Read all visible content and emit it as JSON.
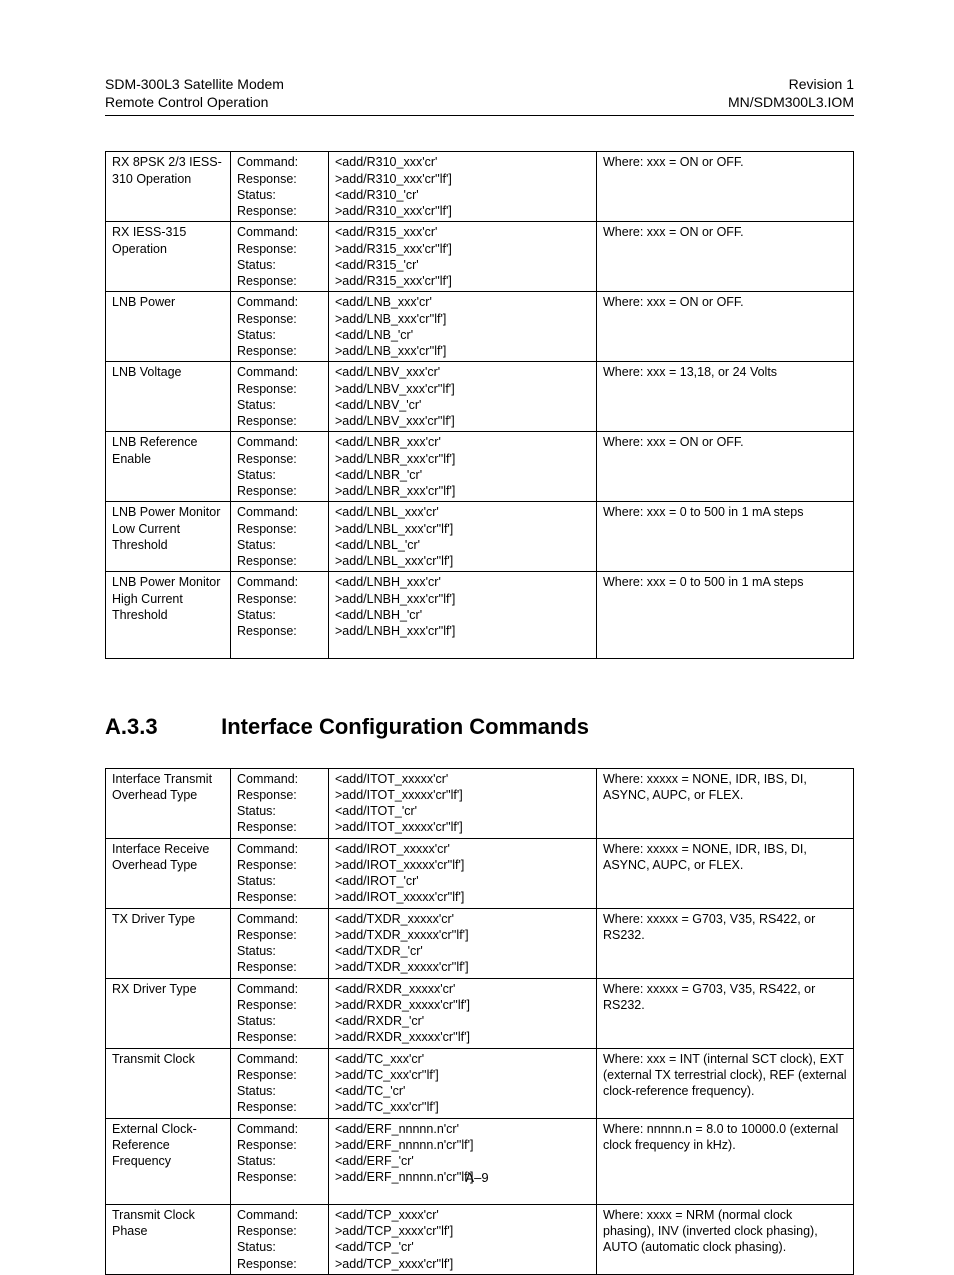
{
  "header": {
    "left1": "SDM-300L3 Satellite Modem",
    "left2": "Remote Control Operation",
    "right1": "Revision 1",
    "right2": "MN/SDM300L3.IOM"
  },
  "labels": {
    "command": "Command:",
    "response": "Response:",
    "status": "Status:"
  },
  "section": {
    "num": "A.3.3",
    "title": "Interface Configuration Commands"
  },
  "table1": [
    {
      "name": "RX 8PSK 2/3 IESS-310 Operation",
      "cmds": [
        "<add/R310_xxx'cr'",
        ">add/R310_xxx'cr''lf']",
        "<add/R310_'cr'",
        ">add/R310_xxx'cr''lf']"
      ],
      "desc": "Where: xxx = ON or OFF."
    },
    {
      "name": "RX IESS-315 Operation",
      "cmds": [
        "<add/R315_xxx'cr'",
        ">add/R315_xxx'cr''lf']",
        "<add/R315_'cr'",
        ">add/R315_xxx'cr''lf']"
      ],
      "desc": "Where: xxx = ON or OFF."
    },
    {
      "name": "LNB Power",
      "cmds": [
        "<add/LNB_xxx'cr'",
        ">add/LNB_xxx'cr''lf']",
        "<add/LNB_'cr'",
        ">add/LNB_xxx'cr''lf']"
      ],
      "desc": "Where: xxx = ON or OFF."
    },
    {
      "name": "LNB Voltage",
      "cmds": [
        "<add/LNBV_xxx'cr'",
        ">add/LNBV_xxx'cr''lf']",
        "<add/LNBV_'cr'",
        ">add/LNBV_xxx'cr''lf']"
      ],
      "desc": "Where: xxx = 13,18, or 24 Volts"
    },
    {
      "name": "LNB Reference Enable",
      "cmds": [
        "<add/LNBR_xxx'cr'",
        ">add/LNBR_xxx'cr''lf']",
        "<add/LNBR_'cr'",
        ">add/LNBR_xxx'cr''lf']"
      ],
      "desc": "Where: xxx = ON or OFF."
    },
    {
      "name": "LNB Power Monitor Low Current Threshold",
      "cmds": [
        "<add/LNBL_xxx'cr'",
        ">add/LNBL_xxx'cr''lf']",
        "<add/LNBL_'cr'",
        ">add/LNBL_xxx'cr''lf']"
      ],
      "desc": "Where: xxx =  0 to 500 in 1 mA steps"
    },
    {
      "name": "LNB Power Monitor High Current Threshold",
      "cmds": [
        "<add/LNBH_xxx'cr'",
        ">add/LNBH_xxx'cr''lf']",
        "<add/LNBH_'cr'",
        ">add/LNBH_xxx'cr''lf']"
      ],
      "desc": "Where: xxx =  0 to 500 in 1 mA steps",
      "pad": true
    }
  ],
  "table2": [
    {
      "name": "Interface Transmit Overhead Type",
      "cmds": [
        "<add/ITOT_xxxxx'cr'",
        ">add/ITOT_xxxxx'cr''lf']",
        "<add/ITOT_'cr'",
        ">add/ITOT_xxxxx'cr''lf']"
      ],
      "desc": "Where: xxxxx = NONE, IDR, IBS, DI, ASYNC, AUPC, or FLEX."
    },
    {
      "name": "Interface Receive Overhead Type",
      "cmds": [
        "<add/IROT_xxxxx'cr'",
        ">add/IROT_xxxxx'cr''lf']",
        "<add/IROT_'cr'",
        ">add/IROT_xxxxx'cr''lf']"
      ],
      "desc": "Where: xxxxx = NONE, IDR, IBS, DI, ASYNC, AUPC, or FLEX."
    },
    {
      "name": "TX Driver Type",
      "cmds": [
        "<add/TXDR_xxxxx'cr'",
        ">add/TXDR_xxxxx'cr''lf']",
        "<add/TXDR_'cr'",
        ">add/TXDR_xxxxx'cr''lf']"
      ],
      "desc": "Where: xxxxx = G703, V35, RS422, or RS232."
    },
    {
      "name": "RX Driver Type",
      "cmds": [
        "<add/RXDR_xxxxx'cr'",
        ">add/RXDR_xxxxx'cr''lf']",
        "<add/RXDR_'cr'",
        ">add/RXDR_xxxxx'cr''lf']"
      ],
      "desc": "Where: xxxxx = G703, V35, RS422, or RS232."
    },
    {
      "name": "Transmit Clock",
      "cmds": [
        "<add/TC_xxx'cr'",
        ">add/TC_xxx'cr''lf']",
        "<add/TC_'cr'",
        ">add/TC_xxx'cr''lf']"
      ],
      "desc": "Where: xxx = INT (internal SCT clock), EXT (external TX terrestrial clock), REF (external clock-reference frequency)."
    },
    {
      "name": "External Clock-Reference Frequency",
      "cmds": [
        "<add/ERF_nnnnn.n'cr'",
        ">add/ERF_nnnnn.n'cr''lf']",
        "<add/ERF_'cr'",
        ">add/ERF_nnnnn.n'cr''lf']"
      ],
      "desc": "Where: nnnnn.n = 8.0 to 10000.0 (external clock frequency in kHz).",
      "pad": true
    },
    {
      "name": "Transmit Clock Phase",
      "cmds": [
        "<add/TCP_xxxx'cr'",
        ">add/TCP_xxxx'cr''lf']",
        "<add/TCP_'cr'",
        ">add/TCP_xxxx'cr''lf']"
      ],
      "desc": "Where: xxxx = NRM (normal clock phasing), INV (inverted clock phasing), AUTO (automatic clock phasing)."
    }
  ],
  "pagenum": "A–9"
}
